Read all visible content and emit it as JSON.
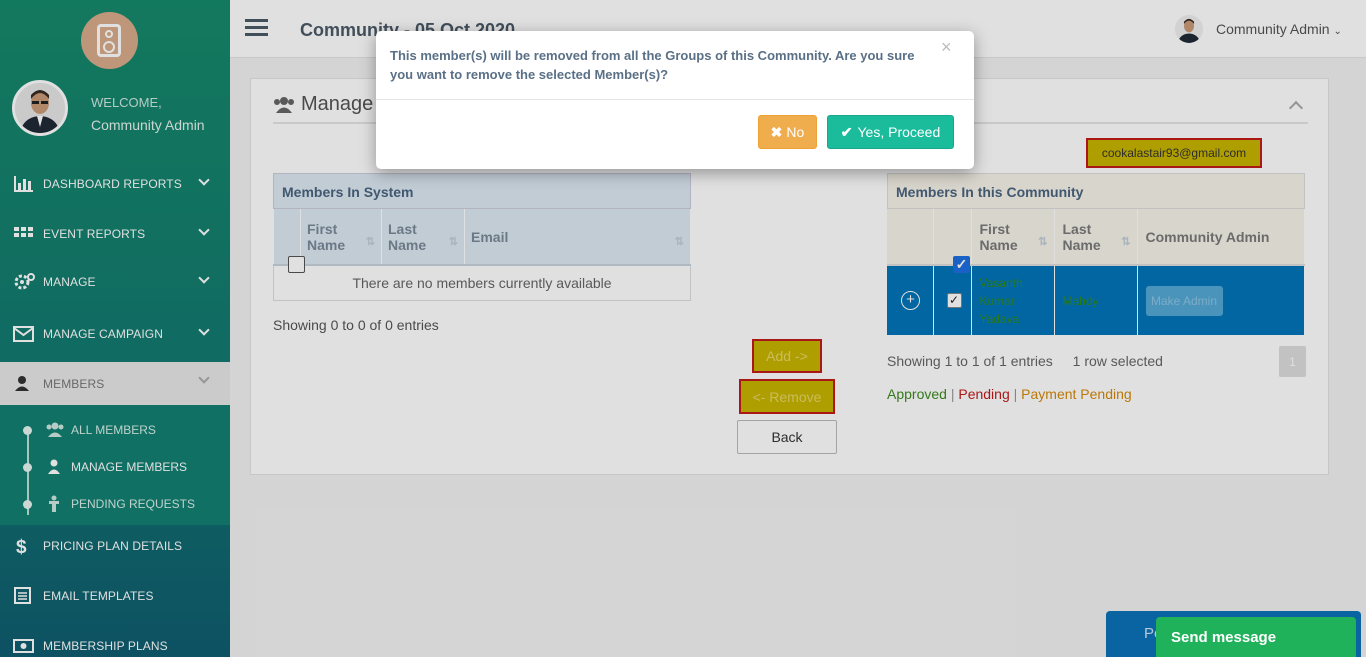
{
  "app": {
    "page_title": "Community - 05 Oct 2020"
  },
  "sidebar": {
    "welcome": "WELCOME,",
    "user_name": "Community Admin",
    "items": [
      {
        "label": "DASHBOARD REPORTS",
        "icon": "bar-chart-icon"
      },
      {
        "label": "EVENT REPORTS",
        "icon": "grid-icon"
      },
      {
        "label": "MANAGE",
        "icon": "gear-icon"
      },
      {
        "label": "MANAGE CAMPAIGN",
        "icon": "envelope-icon"
      },
      {
        "label": "MEMBERS",
        "icon": "user-icon"
      },
      {
        "label": "PRICING PLAN DETAILS",
        "icon": "dollar-icon"
      },
      {
        "label": "EMAIL TEMPLATES",
        "icon": "template-icon"
      },
      {
        "label": "MEMBERSHIP PLANS",
        "icon": "money-icon"
      }
    ],
    "submenu": [
      {
        "label": "ALL MEMBERS",
        "icon": "users-icon"
      },
      {
        "label": "MANAGE MEMBERS",
        "icon": "user-icon"
      },
      {
        "label": "PENDING REQUESTS",
        "icon": "person-pending-icon"
      }
    ]
  },
  "topbar": {
    "user_menu": "Community Admin"
  },
  "panel": {
    "title": "Manage",
    "email_chip": "cookalastair93@gmail.com"
  },
  "left_table": {
    "caption": "Members In System",
    "headers": [
      "First Name",
      "Last Name",
      "Email"
    ],
    "empty_message": "There are no members currently available",
    "showing": "Showing 0 to 0 of 0 entries"
  },
  "right_table": {
    "caption": "Members In this Community",
    "headers": [
      "First Name",
      "Last Name",
      "Community Admin"
    ],
    "rows": [
      {
        "first": "Vasanth Kumar Yadava",
        "last": "Mahdy",
        "action": "Make Admin"
      }
    ],
    "showing": "Showing 1 to 1 of 1 entries",
    "selected": "1 row selected",
    "page": "1"
  },
  "legend": {
    "approved": "Approved",
    "pending": "Pending",
    "payment_pending": "Payment Pending",
    "sep": "|",
    "colors": {
      "approved": "#3c8a1f",
      "pending": "#c21b1b",
      "payment_pending": "#d4890b"
    }
  },
  "actions": {
    "add": "Add ->",
    "remove": "<- Remove",
    "back": "Back"
  },
  "modal": {
    "message": "This member(s) will be removed from all the Groups of this Community. Are you sure you want to remove the selected Member(s)?",
    "close": "×",
    "no_label": "No",
    "yes_label": "Yes, Proceed"
  },
  "chat": {
    "behind_text": "Po",
    "send": "Send message"
  },
  "colors": {
    "sidebar": "#168a6b",
    "accent_yes": "#1abc9c",
    "accent_no": "#f0ad4e",
    "selected_row": "#0275b8"
  }
}
